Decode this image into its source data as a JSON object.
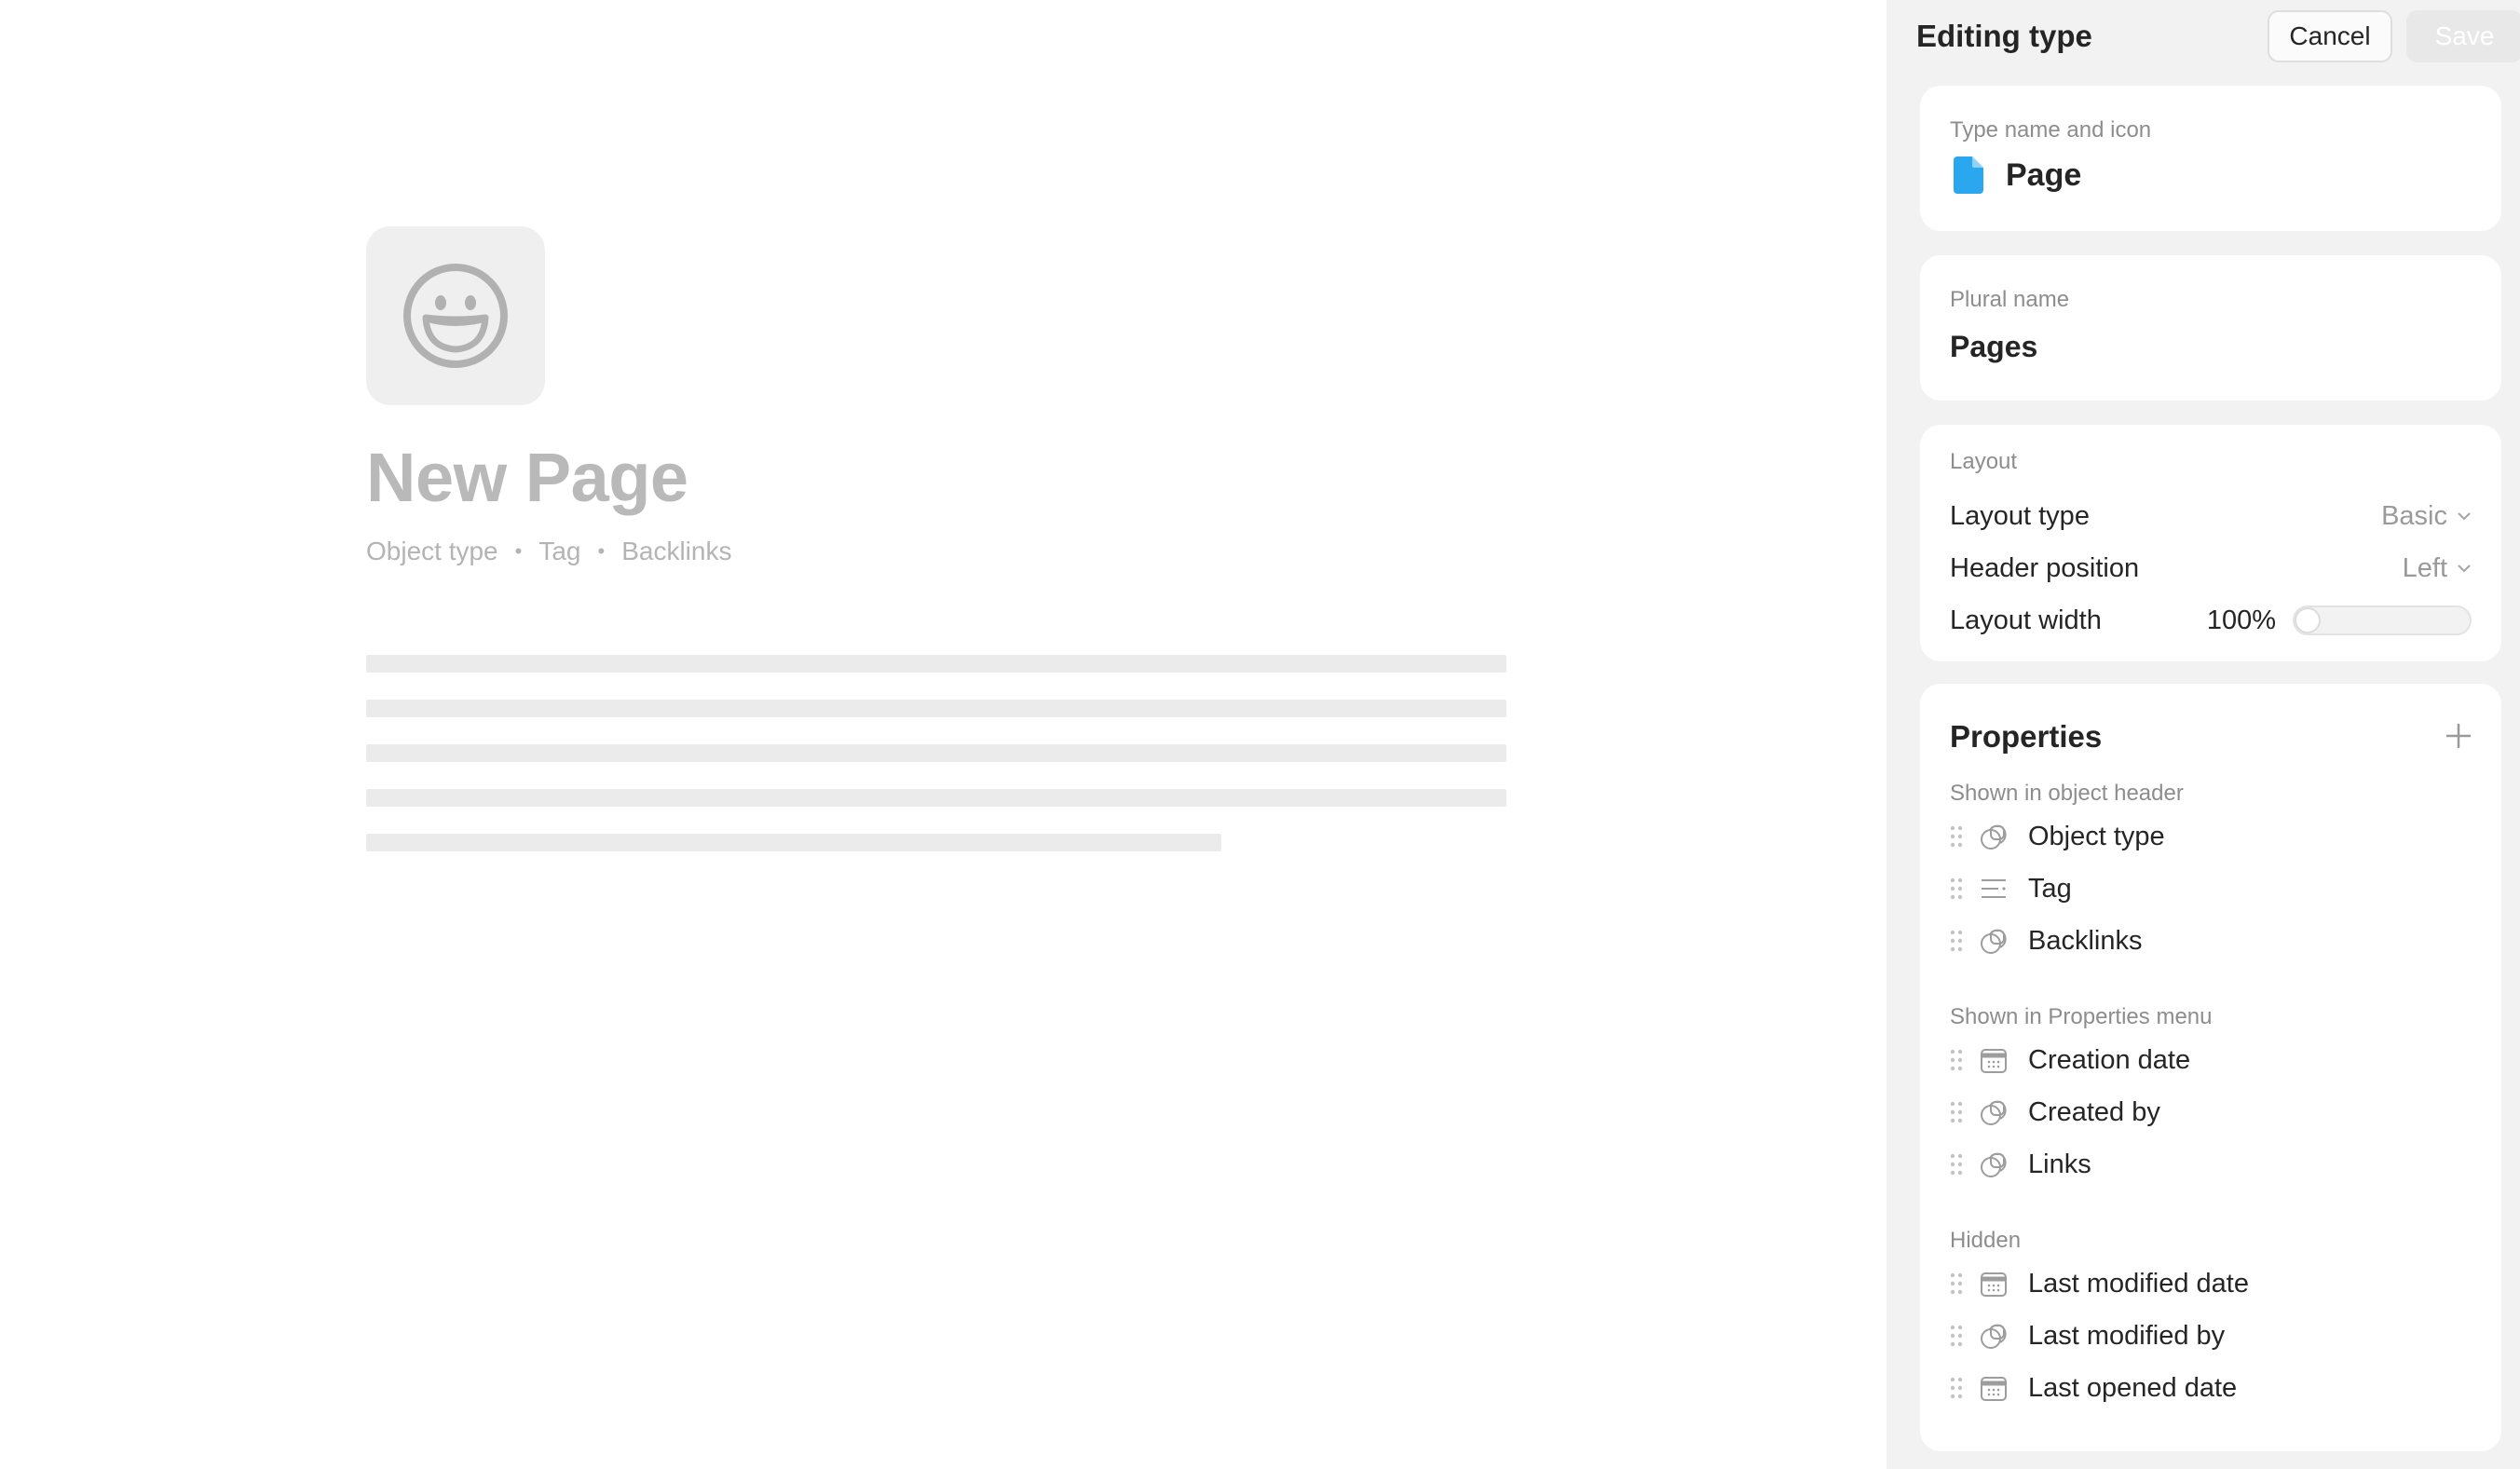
{
  "preview": {
    "title": "New Page",
    "meta": [
      "Object type",
      "Tag",
      "Backlinks"
    ],
    "separator": "•",
    "icon": "smiley-face-icon"
  },
  "panel": {
    "title": "Editing type",
    "cancel_label": "Cancel",
    "save_label": "Save",
    "type_card": {
      "label": "Type name and icon",
      "name": "Page",
      "icon": "page-document-icon",
      "icon_color": "#2aa7ee"
    },
    "plural_card": {
      "label": "Plural name",
      "value": "Pages"
    },
    "layout_card": {
      "label": "Layout",
      "layout_type_label": "Layout type",
      "layout_type_value": "Basic",
      "header_position_label": "Header position",
      "header_position_value": "Left",
      "layout_width_label": "Layout width",
      "layout_width_value": "100%"
    },
    "properties": {
      "title": "Properties",
      "sections": [
        {
          "label": "Shown in object header",
          "items": [
            {
              "label": "Object type",
              "icon": "relation-icon"
            },
            {
              "label": "Tag",
              "icon": "tag-list-icon"
            },
            {
              "label": "Backlinks",
              "icon": "relation-icon"
            }
          ]
        },
        {
          "label": "Shown in Properties menu",
          "items": [
            {
              "label": "Creation date",
              "icon": "calendar-icon"
            },
            {
              "label": "Created by",
              "icon": "relation-icon"
            },
            {
              "label": "Links",
              "icon": "relation-icon"
            }
          ]
        },
        {
          "label": "Hidden",
          "items": [
            {
              "label": "Last modified date",
              "icon": "calendar-icon"
            },
            {
              "label": "Last modified by",
              "icon": "relation-icon"
            },
            {
              "label": "Last opened date",
              "icon": "calendar-icon"
            }
          ]
        }
      ]
    }
  }
}
